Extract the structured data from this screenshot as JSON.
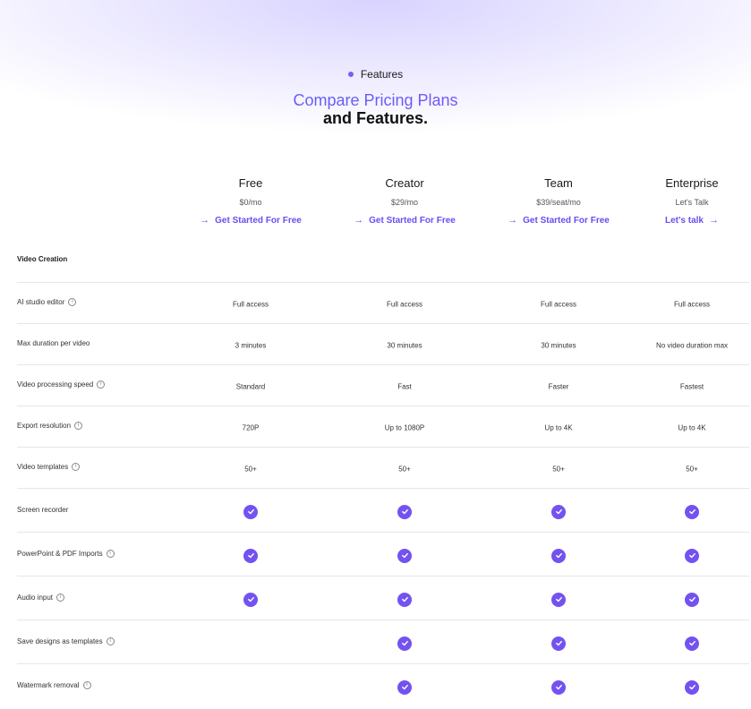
{
  "header": {
    "eyebrow": "Features",
    "title_line1": "Compare Pricing Plans",
    "title_line2": "and Features."
  },
  "plans": [
    {
      "name": "Free",
      "price": "$0/mo",
      "cta": "Get Started For Free",
      "arrow_side": "left"
    },
    {
      "name": "Creator",
      "price": "$29/mo",
      "cta": "Get Started For Free",
      "arrow_side": "left"
    },
    {
      "name": "Team",
      "price": "$39/seat/mo",
      "cta": "Get Started For Free",
      "arrow_side": "left"
    },
    {
      "name": "Enterprise",
      "price": "Let's Talk",
      "cta": "Let's talk",
      "arrow_side": "right"
    }
  ],
  "section": {
    "title": "Video Creation"
  },
  "features": [
    {
      "name": "AI studio editor",
      "info": true,
      "values": [
        "Full access",
        "Full access",
        "Full access",
        "Full access"
      ]
    },
    {
      "name": "Max duration per video",
      "info": false,
      "values": [
        "3 minutes",
        "30 minutes",
        "30 minutes",
        "No video duration max"
      ]
    },
    {
      "name": "Video processing speed",
      "info": true,
      "values": [
        "Standard",
        "Fast",
        "Faster",
        "Fastest"
      ]
    },
    {
      "name": "Export resolution",
      "info": true,
      "values": [
        "720P",
        "Up to 1080P",
        "Up to 4K",
        "Up to 4K"
      ]
    },
    {
      "name": "Video templates",
      "info": true,
      "values": [
        "50+",
        "50+",
        "50+",
        "50+"
      ]
    },
    {
      "name": "Screen recorder",
      "info": false,
      "values": [
        true,
        true,
        true,
        true
      ]
    },
    {
      "name": "PowerPoint & PDF Imports",
      "info": true,
      "values": [
        true,
        true,
        true,
        true
      ]
    },
    {
      "name": "Audio input",
      "info": true,
      "values": [
        true,
        true,
        true,
        true
      ]
    },
    {
      "name": "Save designs as templates",
      "info": true,
      "values": [
        false,
        true,
        true,
        true
      ]
    },
    {
      "name": "Watermark removal",
      "info": true,
      "values": [
        false,
        true,
        true,
        true
      ]
    }
  ],
  "colors": {
    "accent": "#7452f0",
    "link": "#6a4df2"
  },
  "icons": {
    "check": "check-circle-icon",
    "info": "info-icon",
    "arrow": "arrow-right-icon"
  }
}
